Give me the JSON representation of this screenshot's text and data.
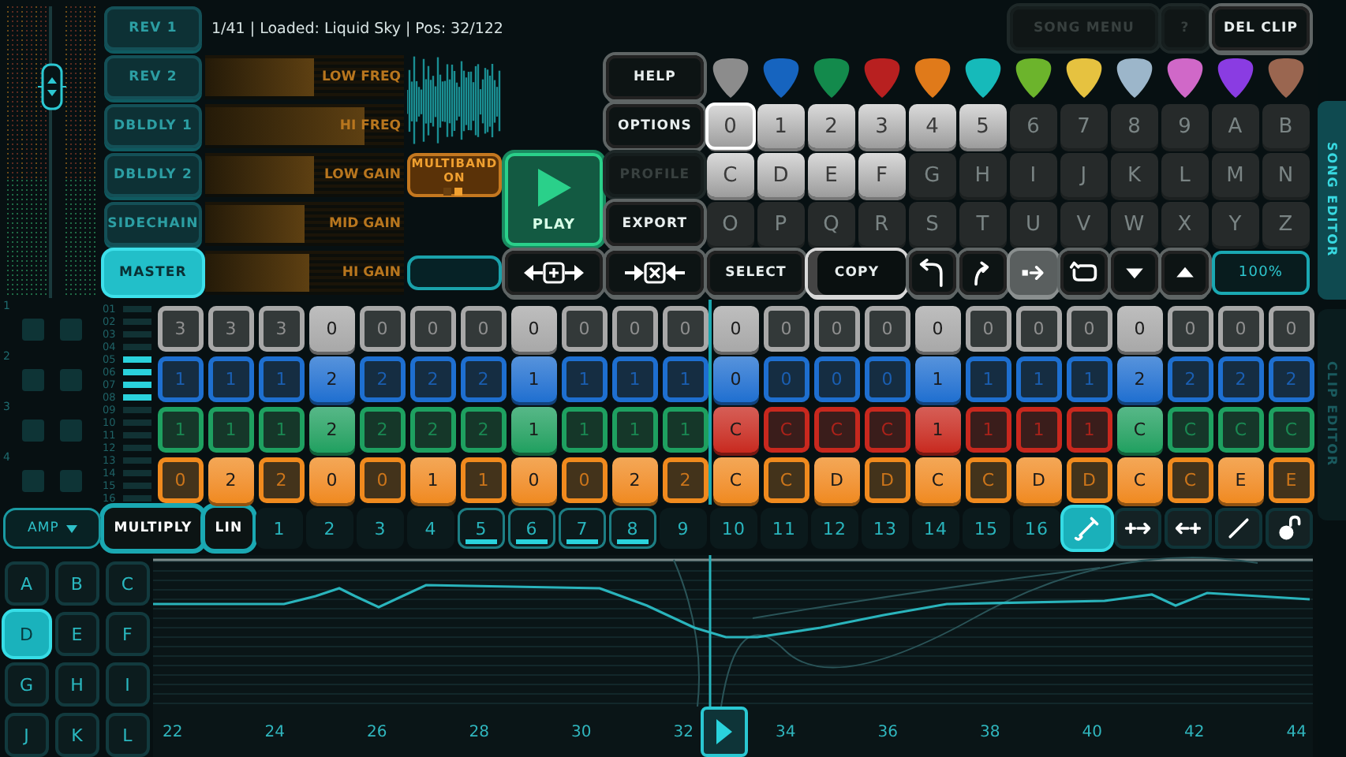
{
  "effects": [
    {
      "label": "REV 1",
      "selected": false
    },
    {
      "label": "REV 2",
      "selected": false
    },
    {
      "label": "DBLDLY 1",
      "selected": false
    },
    {
      "label": "DBLDLY 2",
      "selected": false
    },
    {
      "label": "SIDECHAIN",
      "selected": false
    },
    {
      "label": "MASTER",
      "selected": true
    }
  ],
  "status": "1/41 | Loaded: Liquid Sky | Pos: 32/122",
  "song_buttons": [
    {
      "label": "SONG MENU",
      "disabled": true
    },
    {
      "label": "?",
      "disabled": true
    },
    {
      "label": "DEL CLIP",
      "disabled": false
    }
  ],
  "eq_bands": [
    {
      "label": "LOW FREQ",
      "level": 0.55
    },
    {
      "label": "HI FREQ",
      "level": 0.8
    },
    {
      "label": "LOW GAIN",
      "level": 0.55
    },
    {
      "label": "MID GAIN",
      "level": 0.5
    },
    {
      "label": "HI GAIN",
      "level": 0.52
    }
  ],
  "multiband": {
    "label": "MULTIBAND ON",
    "on": true
  },
  "play": {
    "label": "PLAY"
  },
  "menu_buttons": [
    {
      "label": "HELP",
      "disabled": false
    },
    {
      "label": "OPTIONS",
      "disabled": false
    },
    {
      "label": "PROFILE",
      "disabled": true
    },
    {
      "label": "EXPORT",
      "disabled": false
    }
  ],
  "picks": [
    {
      "color": "#8c8c8c",
      "selected": false
    },
    {
      "color": "#1664bf",
      "selected": false
    },
    {
      "color": "#138a4c",
      "selected": false
    },
    {
      "color": "#b82020",
      "selected": false
    },
    {
      "color": "#e07a1a",
      "selected": false
    },
    {
      "color": "#16baba",
      "selected": false
    },
    {
      "color": "#6cb42c",
      "selected": false
    },
    {
      "color": "#e6c240",
      "selected": false
    },
    {
      "color": "#9cb6ca",
      "selected": false
    },
    {
      "color": "#d068c8",
      "selected": false
    },
    {
      "color": "#8a3ce2",
      "selected": false
    },
    {
      "color": "#9a6650",
      "selected": false
    }
  ],
  "keys": [
    {
      "label": "0",
      "used": true,
      "selected": true
    },
    {
      "label": "1",
      "used": true,
      "selected": false
    },
    {
      "label": "2",
      "used": true,
      "selected": false
    },
    {
      "label": "3",
      "used": true,
      "selected": false
    },
    {
      "label": "4",
      "used": true,
      "selected": false
    },
    {
      "label": "5",
      "used": true,
      "selected": false
    },
    {
      "label": "6",
      "used": false,
      "selected": false
    },
    {
      "label": "7",
      "used": false,
      "selected": false
    },
    {
      "label": "8",
      "used": false,
      "selected": false
    },
    {
      "label": "9",
      "used": false,
      "selected": false
    },
    {
      "label": "A",
      "used": false,
      "selected": false
    },
    {
      "label": "B",
      "used": false,
      "selected": false
    },
    {
      "label": "C",
      "used": true,
      "selected": false
    },
    {
      "label": "D",
      "used": true,
      "selected": false
    },
    {
      "label": "E",
      "used": true,
      "selected": false
    },
    {
      "label": "F",
      "used": true,
      "selected": false
    },
    {
      "label": "G",
      "used": false,
      "selected": false
    },
    {
      "label": "H",
      "used": false,
      "selected": false
    },
    {
      "label": "I",
      "used": false,
      "selected": false
    },
    {
      "label": "J",
      "used": false,
      "selected": false
    },
    {
      "label": "K",
      "used": false,
      "selected": false
    },
    {
      "label": "L",
      "used": false,
      "selected": false
    },
    {
      "label": "M",
      "used": false,
      "selected": false
    },
    {
      "label": "N",
      "used": false,
      "selected": false
    },
    {
      "label": "O",
      "used": false,
      "selected": false
    },
    {
      "label": "P",
      "used": false,
      "selected": false
    },
    {
      "label": "Q",
      "used": false,
      "selected": false
    },
    {
      "label": "R",
      "used": false,
      "selected": false
    },
    {
      "label": "S",
      "used": false,
      "selected": false
    },
    {
      "label": "T",
      "used": false,
      "selected": false
    },
    {
      "label": "U",
      "used": false,
      "selected": false
    },
    {
      "label": "V",
      "used": false,
      "selected": false
    },
    {
      "label": "W",
      "used": false,
      "selected": false
    },
    {
      "label": "X",
      "used": false,
      "selected": false
    },
    {
      "label": "Y",
      "used": false,
      "selected": false
    },
    {
      "label": "Z",
      "used": false,
      "selected": false
    }
  ],
  "toolbar": [
    {
      "kind": "text",
      "label": "SELECT",
      "selected": false
    },
    {
      "kind": "text",
      "label": "COPY",
      "selected": true
    },
    {
      "kind": "undo",
      "selected": false
    },
    {
      "kind": "redo",
      "selected": false
    },
    {
      "kind": "move",
      "selected": true
    },
    {
      "kind": "loop",
      "selected": false
    },
    {
      "kind": "down",
      "selected": false
    },
    {
      "kind": "up",
      "selected": false
    },
    {
      "kind": "zoom",
      "label": "100%",
      "selected": false
    }
  ],
  "tracks": [
    {
      "number": "1",
      "mute": false,
      "solo": false,
      "lanes": [
        {
          "label": "01",
          "selected": false
        },
        {
          "label": "02",
          "selected": false
        },
        {
          "label": "03",
          "selected": false
        },
        {
          "label": "04",
          "selected": false
        }
      ],
      "cells": [
        {
          "label": "3",
          "lit": false,
          "color": "#a8a8a8"
        },
        {
          "label": "3",
          "lit": false,
          "color": "#a8a8a8"
        },
        {
          "label": "3",
          "lit": false,
          "color": "#a8a8a8"
        },
        {
          "label": "0",
          "lit": true,
          "color": "#a8a8a8"
        },
        {
          "label": "0",
          "lit": false,
          "color": "#a8a8a8"
        },
        {
          "label": "0",
          "lit": false,
          "color": "#a8a8a8"
        },
        {
          "label": "0",
          "lit": false,
          "color": "#a8a8a8"
        },
        {
          "label": "0",
          "lit": true,
          "color": "#a8a8a8"
        },
        {
          "label": "0",
          "lit": false,
          "color": "#a8a8a8"
        },
        {
          "label": "0",
          "lit": false,
          "color": "#a8a8a8"
        },
        {
          "label": "0",
          "lit": false,
          "color": "#a8a8a8"
        },
        {
          "label": "0",
          "lit": true,
          "color": "#a8a8a8"
        },
        {
          "label": "0",
          "lit": false,
          "color": "#a8a8a8"
        },
        {
          "label": "0",
          "lit": false,
          "color": "#a8a8a8"
        },
        {
          "label": "0",
          "lit": false,
          "color": "#a8a8a8"
        },
        {
          "label": "0",
          "lit": true,
          "color": "#a8a8a8"
        },
        {
          "label": "0",
          "lit": false,
          "color": "#a8a8a8"
        },
        {
          "label": "0",
          "lit": false,
          "color": "#a8a8a8"
        },
        {
          "label": "0",
          "lit": false,
          "color": "#a8a8a8"
        },
        {
          "label": "0",
          "lit": true,
          "color": "#a8a8a8"
        },
        {
          "label": "0",
          "lit": false,
          "color": "#a8a8a8"
        },
        {
          "label": "0",
          "lit": false,
          "color": "#a8a8a8"
        },
        {
          "label": "0",
          "lit": false,
          "color": "#a8a8a8"
        }
      ]
    },
    {
      "number": "2",
      "mute": false,
      "solo": false,
      "lanes": [
        {
          "label": "05",
          "selected": true
        },
        {
          "label": "06",
          "selected": true
        },
        {
          "label": "07",
          "selected": true
        },
        {
          "label": "08",
          "selected": true
        }
      ],
      "cells": [
        {
          "label": "1",
          "lit": false,
          "color": "#1e6fd0"
        },
        {
          "label": "1",
          "lit": false,
          "color": "#1e6fd0"
        },
        {
          "label": "1",
          "lit": false,
          "color": "#1e6fd0"
        },
        {
          "label": "2",
          "lit": true,
          "color": "#1e6fd0"
        },
        {
          "label": "2",
          "lit": false,
          "color": "#1e6fd0"
        },
        {
          "label": "2",
          "lit": false,
          "color": "#1e6fd0"
        },
        {
          "label": "2",
          "lit": false,
          "color": "#1e6fd0"
        },
        {
          "label": "1",
          "lit": true,
          "color": "#1e6fd0"
        },
        {
          "label": "1",
          "lit": false,
          "color": "#1e6fd0"
        },
        {
          "label": "1",
          "lit": false,
          "color": "#1e6fd0"
        },
        {
          "label": "1",
          "lit": false,
          "color": "#1e6fd0"
        },
        {
          "label": "0",
          "lit": true,
          "color": "#1e6fd0"
        },
        {
          "label": "0",
          "lit": false,
          "color": "#1e6fd0"
        },
        {
          "label": "0",
          "lit": false,
          "color": "#1e6fd0"
        },
        {
          "label": "0",
          "lit": false,
          "color": "#1e6fd0"
        },
        {
          "label": "1",
          "lit": true,
          "color": "#1e6fd0"
        },
        {
          "label": "1",
          "lit": false,
          "color": "#1e6fd0"
        },
        {
          "label": "1",
          "lit": false,
          "color": "#1e6fd0"
        },
        {
          "label": "1",
          "lit": false,
          "color": "#1e6fd0"
        },
        {
          "label": "2",
          "lit": true,
          "color": "#1e6fd0"
        },
        {
          "label": "2",
          "lit": false,
          "color": "#1e6fd0"
        },
        {
          "label": "2",
          "lit": false,
          "color": "#1e6fd0"
        },
        {
          "label": "2",
          "lit": false,
          "color": "#1e6fd0"
        }
      ]
    },
    {
      "number": "3",
      "mute": false,
      "solo": false,
      "lanes": [
        {
          "label": "09",
          "selected": false
        },
        {
          "label": "10",
          "selected": false
        },
        {
          "label": "11",
          "selected": false
        },
        {
          "label": "12",
          "selected": false
        }
      ],
      "cells": [
        {
          "label": "1",
          "lit": false,
          "color": "#1ea060"
        },
        {
          "label": "1",
          "lit": false,
          "color": "#1ea060"
        },
        {
          "label": "1",
          "lit": false,
          "color": "#1ea060"
        },
        {
          "label": "2",
          "lit": true,
          "color": "#1ea060"
        },
        {
          "label": "2",
          "lit": false,
          "color": "#1ea060"
        },
        {
          "label": "2",
          "lit": false,
          "color": "#1ea060"
        },
        {
          "label": "2",
          "lit": false,
          "color": "#1ea060"
        },
        {
          "label": "1",
          "lit": true,
          "color": "#1ea060"
        },
        {
          "label": "1",
          "lit": false,
          "color": "#1ea060"
        },
        {
          "label": "1",
          "lit": false,
          "color": "#1ea060"
        },
        {
          "label": "1",
          "lit": false,
          "color": "#1ea060"
        },
        {
          "label": "C",
          "lit": true,
          "color": "#c8281e"
        },
        {
          "label": "C",
          "lit": false,
          "color": "#c8281e"
        },
        {
          "label": "C",
          "lit": false,
          "color": "#c8281e"
        },
        {
          "label": "C",
          "lit": false,
          "color": "#c8281e"
        },
        {
          "label": "1",
          "lit": true,
          "color": "#c8281e"
        },
        {
          "label": "1",
          "lit": false,
          "color": "#c8281e"
        },
        {
          "label": "1",
          "lit": false,
          "color": "#c8281e"
        },
        {
          "label": "1",
          "lit": false,
          "color": "#c8281e"
        },
        {
          "label": "C",
          "lit": true,
          "color": "#1ea060"
        },
        {
          "label": "C",
          "lit": false,
          "color": "#1ea060"
        },
        {
          "label": "C",
          "lit": false,
          "color": "#1ea060"
        },
        {
          "label": "C",
          "lit": false,
          "color": "#1ea060"
        }
      ]
    },
    {
      "number": "4",
      "mute": false,
      "solo": false,
      "lanes": [
        {
          "label": "13",
          "selected": false
        },
        {
          "label": "14",
          "selected": false
        },
        {
          "label": "15",
          "selected": false
        },
        {
          "label": "16",
          "selected": false
        }
      ],
      "cells": [
        {
          "label": "0",
          "lit": false,
          "color": "#f08a1e"
        },
        {
          "label": "2",
          "lit": true,
          "color": "#f08a1e"
        },
        {
          "label": "2",
          "lit": false,
          "color": "#f08a1e"
        },
        {
          "label": "0",
          "lit": true,
          "color": "#f08a1e"
        },
        {
          "label": "0",
          "lit": false,
          "color": "#f08a1e"
        },
        {
          "label": "1",
          "lit": true,
          "color": "#f08a1e"
        },
        {
          "label": "1",
          "lit": false,
          "color": "#f08a1e"
        },
        {
          "label": "0",
          "lit": true,
          "color": "#f08a1e"
        },
        {
          "label": "0",
          "lit": false,
          "color": "#f08a1e"
        },
        {
          "label": "2",
          "lit": true,
          "color": "#f08a1e"
        },
        {
          "label": "2",
          "lit": false,
          "color": "#f08a1e"
        },
        {
          "label": "C",
          "lit": true,
          "color": "#f08a1e"
        },
        {
          "label": "C",
          "lit": false,
          "color": "#f08a1e"
        },
        {
          "label": "D",
          "lit": true,
          "color": "#f08a1e"
        },
        {
          "label": "D",
          "lit": false,
          "color": "#f08a1e"
        },
        {
          "label": "C",
          "lit": true,
          "color": "#f08a1e"
        },
        {
          "label": "C",
          "lit": false,
          "color": "#f08a1e"
        },
        {
          "label": "D",
          "lit": true,
          "color": "#f08a1e"
        },
        {
          "label": "D",
          "lit": false,
          "color": "#f08a1e"
        },
        {
          "label": "C",
          "lit": true,
          "color": "#f08a1e"
        },
        {
          "label": "C",
          "lit": false,
          "color": "#f08a1e"
        },
        {
          "label": "E",
          "lit": true,
          "color": "#f08a1e"
        },
        {
          "label": "E",
          "lit": false,
          "color": "#f08a1e"
        }
      ]
    }
  ],
  "parameter": {
    "label": "AMP"
  },
  "modes": [
    {
      "label": "MULTIPLY",
      "on": true
    },
    {
      "label": "LIN",
      "on": true
    }
  ],
  "steps": [
    {
      "label": "1",
      "selected": false
    },
    {
      "label": "2",
      "selected": false
    },
    {
      "label": "3",
      "selected": false
    },
    {
      "label": "4",
      "selected": false
    },
    {
      "label": "5",
      "selected": true
    },
    {
      "label": "6",
      "selected": true
    },
    {
      "label": "7",
      "selected": true
    },
    {
      "label": "8",
      "selected": true
    },
    {
      "label": "9",
      "selected": false
    },
    {
      "label": "10",
      "selected": false
    },
    {
      "label": "11",
      "selected": false
    },
    {
      "label": "12",
      "selected": false
    },
    {
      "label": "13",
      "selected": false
    },
    {
      "label": "14",
      "selected": false
    },
    {
      "label": "15",
      "selected": false
    },
    {
      "label": "16",
      "selected": false
    }
  ],
  "tools": [
    {
      "kind": "draw",
      "selected": true
    },
    {
      "kind": "extend_right",
      "selected": false
    },
    {
      "kind": "extend_left",
      "selected": false
    },
    {
      "kind": "line",
      "selected": false
    },
    {
      "kind": "lock",
      "selected": false
    }
  ],
  "banks": [
    {
      "label": "A",
      "selected": false
    },
    {
      "label": "B",
      "selected": false
    },
    {
      "label": "C",
      "selected": false
    },
    {
      "label": "D",
      "selected": true
    },
    {
      "label": "E",
      "selected": false
    },
    {
      "label": "F",
      "selected": false
    },
    {
      "label": "G",
      "selected": false
    },
    {
      "label": "H",
      "selected": false
    },
    {
      "label": "I",
      "selected": false
    },
    {
      "label": "J",
      "selected": false
    },
    {
      "label": "K",
      "selected": false
    },
    {
      "label": "L",
      "selected": false
    }
  ],
  "timeline": [
    "22",
    "24",
    "26",
    "28",
    "30",
    "32",
    "34",
    "36",
    "38",
    "40",
    "42",
    "44"
  ],
  "side_tabs": [
    {
      "label": "SONG EDITOR",
      "selected": true
    },
    {
      "label": "CLIP EDITOR",
      "selected": false
    }
  ]
}
